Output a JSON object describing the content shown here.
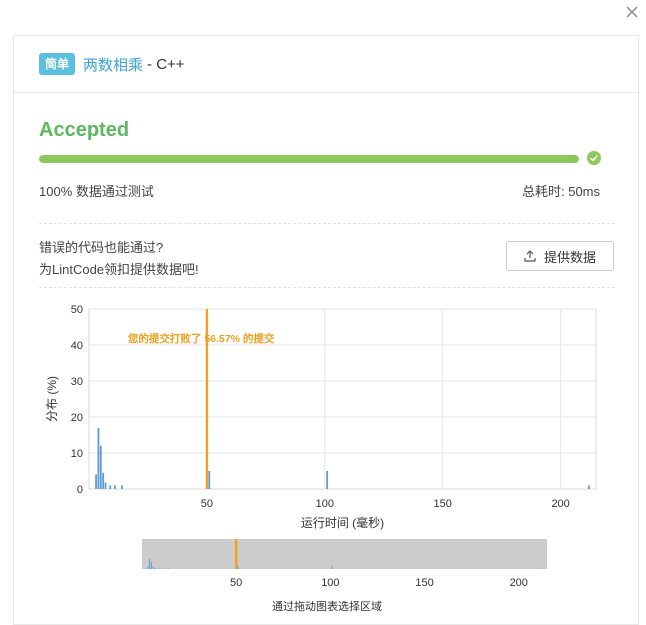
{
  "problem": {
    "difficulty": "简单",
    "title": "两数相乘",
    "language": "- C++"
  },
  "result": {
    "status": "Accepted",
    "pass_rate": 1.0,
    "pass_text": "100%  数据通过测试",
    "runtime_text": "总耗时: 50ms"
  },
  "hint": {
    "line1": "错误的代码也能通过?",
    "line2": "为LintCode领扣提供数据吧!"
  },
  "provide_button": {
    "label": "提供数据"
  },
  "icons": {
    "close": "close-icon",
    "check": "check-circle-icon",
    "upload": "upload-icon"
  },
  "colors": {
    "accent": "#5cb85c",
    "progress": "#8cc95a",
    "marker": "#f0a020",
    "bars": "#5b9bd5",
    "badge": "#5bc0de"
  },
  "chart_data": {
    "type": "bar",
    "xlabel": "运行时间 (毫秒)",
    "ylabel": "分布 (%)",
    "xlim": [
      0,
      215
    ],
    "ylim": [
      0,
      50
    ],
    "xticks": [
      50,
      100,
      150,
      200
    ],
    "yticks": [
      0,
      10,
      20,
      30,
      40,
      50
    ],
    "bars": [
      {
        "x": 3,
        "y": 4
      },
      {
        "x": 4,
        "y": 17
      },
      {
        "x": 5,
        "y": 12
      },
      {
        "x": 6,
        "y": 4.5
      },
      {
        "x": 7,
        "y": 1.8
      },
      {
        "x": 9,
        "y": 1
      },
      {
        "x": 11,
        "y": 1
      },
      {
        "x": 14,
        "y": 1
      },
      {
        "x": 50,
        "y": 50
      },
      {
        "x": 51,
        "y": 5
      },
      {
        "x": 101,
        "y": 5
      },
      {
        "x": 212,
        "y": 1
      }
    ],
    "marker": {
      "x": 50,
      "label": "您的提交打败了 56.57% 的提交"
    },
    "navigator": {
      "caption": "通过拖动图表选择区域",
      "xticks": [
        50,
        100,
        150,
        200
      ]
    }
  }
}
